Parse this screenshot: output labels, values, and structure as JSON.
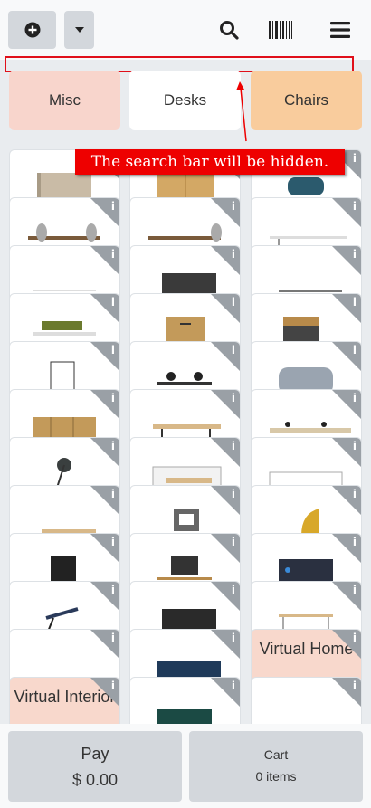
{
  "toolbar": {
    "add_icon": "plus-circle-icon",
    "dropdown_icon": "caret-down-icon",
    "search_icon": "search-icon",
    "barcode_icon": "barcode-icon",
    "menu_icon": "hamburger-menu-icon"
  },
  "categories": [
    {
      "label": "Misc",
      "color": "#f8d5cc"
    },
    {
      "label": "Desks",
      "color": "#ffffff"
    },
    {
      "label": "Chairs",
      "color": "#f9cc9d"
    }
  ],
  "annotation": {
    "text": "The search bar will be hidden.",
    "color": "#ee0000"
  },
  "products": {
    "virtual_home": "Virtual Home",
    "virtual_interior": "Virtual Interior",
    "info_glyph": "i"
  },
  "actions": {
    "pay_label": "Pay",
    "pay_amount": "$ 0.00",
    "cart_label": "Cart",
    "cart_count": "0 items"
  }
}
